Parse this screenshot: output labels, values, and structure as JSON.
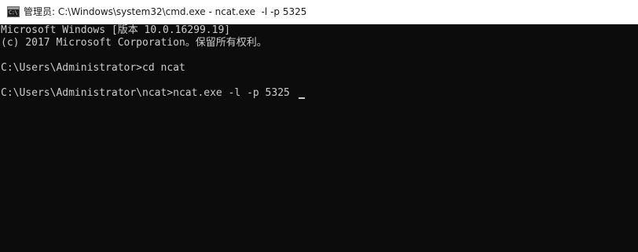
{
  "window": {
    "icon_text": "C:\\",
    "title": "管理员: C:\\Windows\\system32\\cmd.exe - ncat.exe  -l -p 5325"
  },
  "console": {
    "lines": [
      "Microsoft Windows [版本 10.0.16299.19]",
      "(c) 2017 Microsoft Corporation。保留所有权利。",
      "C:\\Users\\Administrator>cd ncat",
      "C:\\Users\\Administrator\\ncat>ncat.exe -l -p 5325"
    ]
  },
  "colors": {
    "console_bg": "#0c0c0c",
    "console_fg": "#cccccc",
    "titlebar_bg": "#ffffff"
  }
}
